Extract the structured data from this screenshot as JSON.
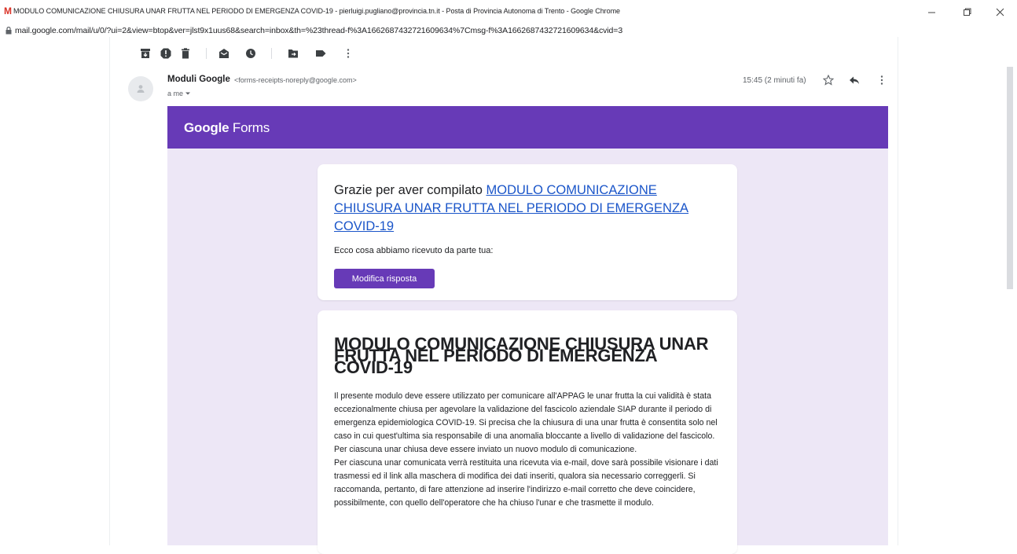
{
  "window": {
    "title": "MODULO COMUNICAZIONE CHIUSURA UNAR FRUTTA NEL PERIODO DI EMERGENZA COVID-19 - pierluigi.pugliano@provincia.tn.it - Posta di Provincia Autonoma di Trento - Google Chrome",
    "url": "mail.google.com/mail/u/0/?ui=2&view=btop&ver=jlst9x1uus68&search=inbox&th=%23thread-f%3A1662687432721609634%7Cmsg-f%3A1662687432721609634&cvid=3"
  },
  "email": {
    "sender_name": "Moduli Google",
    "sender_email": "<forms-receipts-noreply@google.com>",
    "recipient": "a me",
    "timestamp": "15:45 (2 minuti fa)"
  },
  "banner": {
    "brand": "Google",
    "product": "Forms"
  },
  "confirmation": {
    "thanks_prefix": "Grazie per aver compilato ",
    "form_link": "MODULO COMUNICAZIONE CHIUSURA UNAR FRUTTA NEL PERIODO DI EMERGENZA COVID-19",
    "received": "Ecco cosa abbiamo ricevuto da parte tua:",
    "edit_button": "Modifica risposta"
  },
  "form": {
    "title": "MODULO COMUNICAZIONE CHIUSURA UNAR FRUTTA NEL PERIODO DI EMERGENZA COVID-19",
    "paragraphs": [
      "Il presente modulo deve essere utilizzato per comunicare all'APPAG le unar frutta  la cui validità è stata eccezionalmente chiusa per agevolare la validazione del fascicolo aziendale SIAP durante il periodo di emergenza epidemiologica COVID-19. Si precisa che la chiusura di una unar frutta è consentita solo nel caso in cui quest'ultima sia responsabile di una anomalia bloccante a livello di validazione del fascicolo.",
      "Per ciascuna unar chiusa deve essere inviato un nuovo modulo di comunicazione.",
      "Per ciascuna unar comunicata verrà restituita una ricevuta via e-mail, dove sarà possibile visionare i dati trasmessi ed il link alla maschera di modifica dei dati inseriti, qualora sia necessario correggerli. Si raccomanda, pertanto, di fare attenzione ad inserire l'indirizzo e-mail corretto che deve coincidere, possibilmente, con quello dell'operatore che ha chiuso l'unar e che trasmette il modulo."
    ]
  },
  "colors": {
    "forms_purple": "#673ab7",
    "forms_background": "#ede7f6",
    "link_blue": "#1a55c9"
  },
  "icons": {
    "gmail": "gmail-icon",
    "lock": "lock-icon",
    "toolbar": [
      "archive-icon",
      "report-spam-icon",
      "delete-icon",
      "mark-unread-icon",
      "snooze-icon",
      "move-to-icon",
      "label-icon",
      "more-vert-icon"
    ],
    "header": [
      "star-icon",
      "reply-icon",
      "more-vert-icon"
    ]
  }
}
